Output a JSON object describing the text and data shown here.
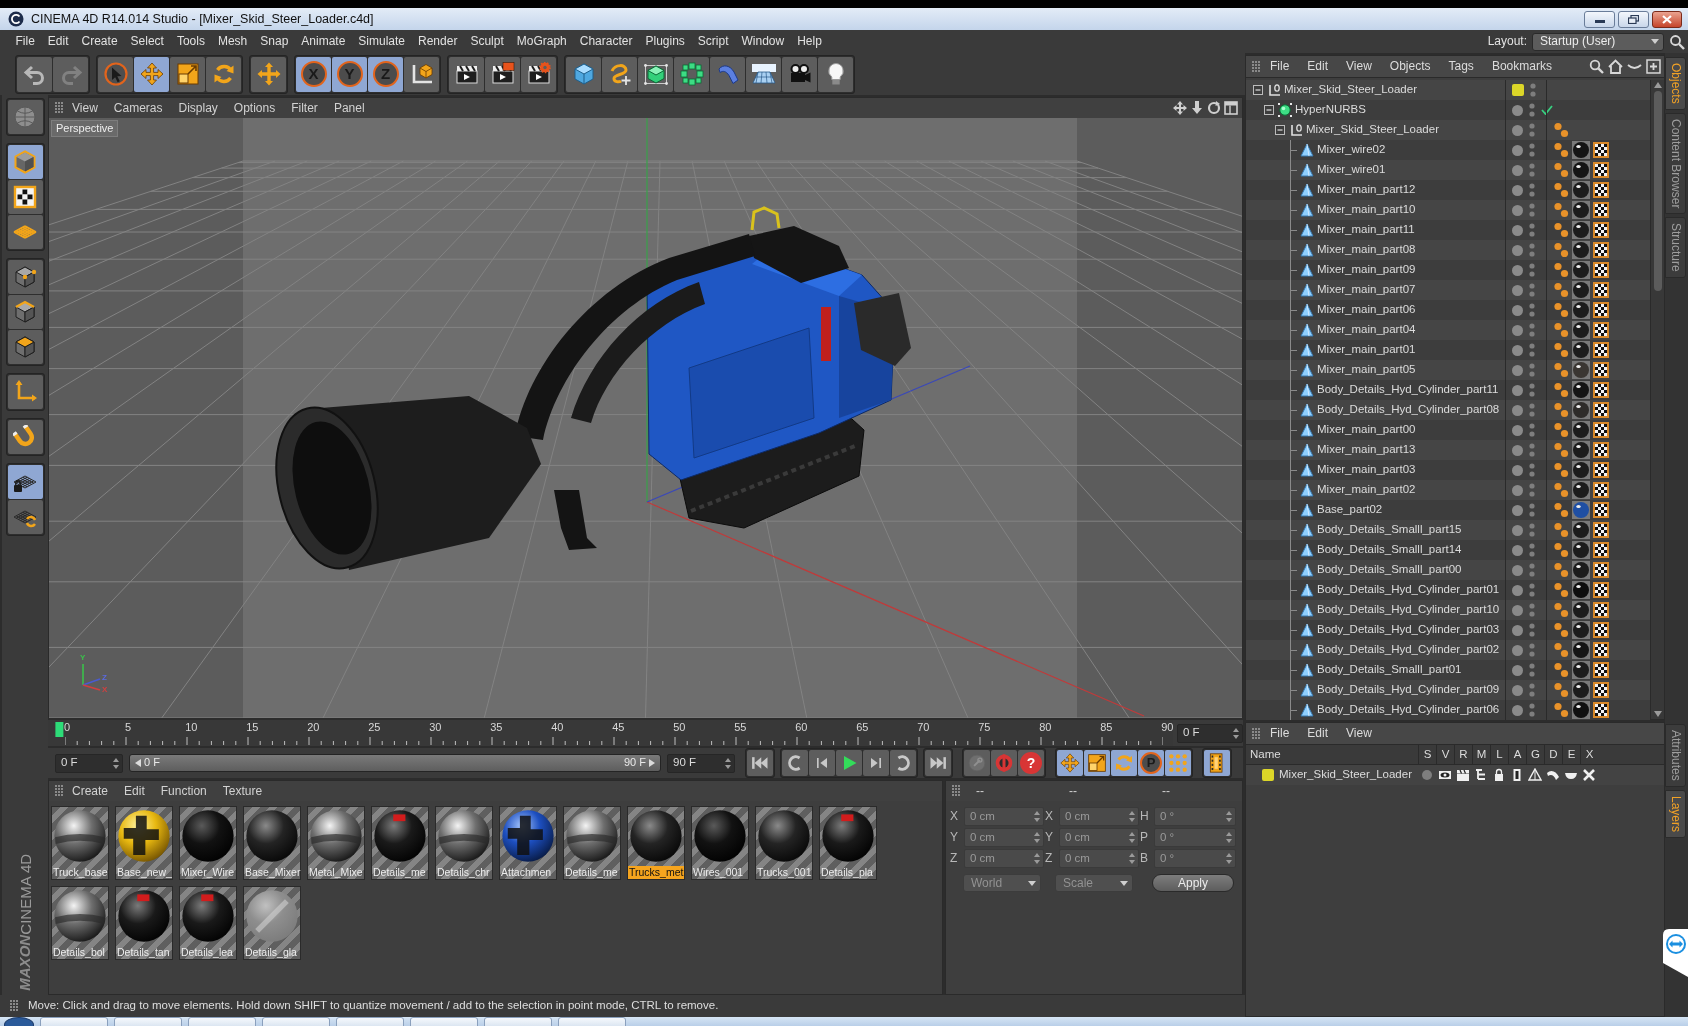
{
  "window": {
    "title": "CINEMA 4D R14.014 Studio - [Mixer_Skid_Steer_Loader.c4d]"
  },
  "menu": [
    "File",
    "Edit",
    "Create",
    "Select",
    "Tools",
    "Mesh",
    "Snap",
    "Animate",
    "Simulate",
    "Render",
    "Sculpt",
    "MoGraph",
    "Character",
    "Plugins",
    "Script",
    "Window",
    "Help"
  ],
  "layout": {
    "label": "Layout:",
    "value": "Startup (User)"
  },
  "toolbar": [
    [
      {
        "kind": "undo",
        "active": false,
        "disabled": false
      },
      {
        "kind": "redo",
        "active": false,
        "disabled": true
      }
    ],
    [
      {
        "kind": "select",
        "active": false,
        "disabled": false
      },
      {
        "kind": "move",
        "active": true,
        "disabled": false
      },
      {
        "kind": "scale",
        "active": false,
        "disabled": false
      },
      {
        "kind": "rotate",
        "active": false,
        "disabled": false
      }
    ],
    [
      {
        "kind": "last",
        "active": false,
        "disabled": false
      }
    ],
    [
      {
        "kind": "axis",
        "label": "X",
        "active": true,
        "disabled": false
      },
      {
        "kind": "axis",
        "label": "Y",
        "active": true,
        "disabled": false
      },
      {
        "kind": "axis",
        "label": "Z",
        "active": true,
        "disabled": false
      },
      {
        "kind": "coords",
        "active": false,
        "disabled": false
      }
    ],
    [
      {
        "kind": "renderview",
        "active": false,
        "disabled": false
      },
      {
        "kind": "renderpv",
        "active": false,
        "disabled": false
      },
      {
        "kind": "rendersettings",
        "active": false,
        "disabled": false
      }
    ],
    [
      {
        "kind": "cube",
        "active": false,
        "disabled": false
      },
      {
        "kind": "pen",
        "active": false,
        "disabled": false
      },
      {
        "kind": "subdivision",
        "active": false,
        "disabled": false
      },
      {
        "kind": "array",
        "active": false,
        "disabled": false
      },
      {
        "kind": "deformer",
        "active": false,
        "disabled": false
      },
      {
        "kind": "floor",
        "active": false,
        "disabled": false
      },
      {
        "kind": "camera",
        "active": false,
        "disabled": false
      },
      {
        "kind": "light",
        "active": false,
        "disabled": false
      }
    ]
  ],
  "left_tools": [
    [
      {
        "kind": "editable",
        "active": false
      }
    ],
    [
      {
        "kind": "model",
        "active": true
      },
      {
        "kind": "texture",
        "active": false
      },
      {
        "kind": "workplane",
        "active": false
      }
    ],
    [
      {
        "kind": "points",
        "active": false
      },
      {
        "kind": "edges",
        "active": false
      },
      {
        "kind": "polygons",
        "active": false
      }
    ],
    [
      {
        "kind": "axis",
        "active": false
      }
    ],
    [
      {
        "kind": "tweak",
        "active": false
      }
    ],
    [
      {
        "kind": "snap",
        "active": true
      },
      {
        "kind": "snapsettings",
        "active": false
      }
    ]
  ],
  "logo": {
    "brand": "MAXON",
    "product": "CINEMA 4D"
  },
  "viewport": {
    "menu": [
      "View",
      "Cameras",
      "Display",
      "Options",
      "Filter",
      "Panel"
    ],
    "camera": "Perspective",
    "gizmo": [
      "Y",
      "Z",
      "X"
    ]
  },
  "timeline": {
    "ticks": [
      "0",
      "5",
      "10",
      "15",
      "20",
      "25",
      "30",
      "35",
      "40",
      "45",
      "50",
      "55",
      "60",
      "65",
      "70",
      "75",
      "80",
      "85",
      "90"
    ],
    "playhead": {
      "level": 0
    },
    "frame": "0 F"
  },
  "playback": {
    "start": "0 F",
    "range": {
      "start": "0 F",
      "end": "90 F"
    },
    "end": "90 F",
    "transport": [
      [
        {
          "kind": "first"
        }
      ],
      [
        {
          "kind": "prevkey"
        },
        {
          "kind": "prevframe"
        },
        {
          "kind": "play"
        },
        {
          "kind": "nextframe"
        },
        {
          "kind": "nextkey"
        }
      ],
      [
        {
          "kind": "last"
        }
      ]
    ],
    "keys": [
      {
        "kind": "record",
        "disabled": true
      },
      {
        "kind": "autokey",
        "disabled": false
      },
      {
        "kind": "keyset",
        "label": "?",
        "disabled": false
      }
    ],
    "filters": [
      {
        "kind": "position",
        "active": true
      },
      {
        "kind": "scale",
        "active": true
      },
      {
        "kind": "rotation",
        "active": true
      },
      {
        "kind": "parameter",
        "label": "P",
        "active": true
      },
      {
        "kind": "points",
        "active": true
      }
    ],
    "timeline_active": true
  },
  "materials": {
    "menu": [
      "Create",
      "Edit",
      "Function",
      "Texture"
    ],
    "items": [
      {
        "name": "Truck_base",
        "kind": "chrome",
        "selected": false
      },
      {
        "name": "Base_new_",
        "kind": "yellow",
        "selected": false
      },
      {
        "name": "Mixer_Wire",
        "kind": "black",
        "selected": false
      },
      {
        "name": "Base_Mixer",
        "kind": "dark",
        "selected": false
      },
      {
        "name": "Metal_Mixe",
        "kind": "chrome",
        "selected": false
      },
      {
        "name": "Details_me",
        "kind": "tagged",
        "selected": false
      },
      {
        "name": "Details_chr",
        "kind": "chrome",
        "selected": false
      },
      {
        "name": "Attachmen",
        "kind": "blue",
        "selected": false
      },
      {
        "name": "Details_me",
        "kind": "chrome",
        "selected": false
      },
      {
        "name": "Trucks_met",
        "kind": "dark",
        "selected": true
      },
      {
        "name": "Wires_001",
        "kind": "black",
        "selected": false
      },
      {
        "name": "Trucks_001",
        "kind": "dark",
        "selected": false
      },
      {
        "name": "Details_pla",
        "kind": "tagged",
        "selected": false
      },
      {
        "name": "Details_bol",
        "kind": "chrome",
        "selected": false
      },
      {
        "name": "Details_tan",
        "kind": "tagged",
        "selected": false
      },
      {
        "name": "Details_lea",
        "kind": "tagged",
        "selected": false
      },
      {
        "name": "Details_gla",
        "kind": "glass",
        "selected": false
      }
    ]
  },
  "coordinates": {
    "disabled": true,
    "headers": [
      "--",
      "--",
      "--"
    ],
    "columns": [
      [
        {
          "axis": "X",
          "value": "0 cm"
        },
        {
          "axis": "Y",
          "value": "0 cm"
        },
        {
          "axis": "Z",
          "value": "0 cm"
        }
      ],
      [
        {
          "axis": "X",
          "value": "0 cm"
        },
        {
          "axis": "Y",
          "value": "0 cm"
        },
        {
          "axis": "Z",
          "value": "0 cm"
        }
      ],
      [
        {
          "axis": "H",
          "value": "0 °"
        },
        {
          "axis": "P",
          "value": "0 °"
        },
        {
          "axis": "B",
          "value": "0 °"
        }
      ]
    ],
    "dropdowns": [
      "World",
      "Scale"
    ],
    "apply": "Apply"
  },
  "objects": {
    "menu": [
      "File",
      "Edit",
      "View",
      "Objects",
      "Tags",
      "Bookmarks"
    ],
    "tree": [
      {
        "name": "Mixer_Skid_Steer_Loader",
        "kind": "null",
        "expanded": true,
        "color": "#dcd628",
        "children": [
          {
            "name": "HyperNURBS",
            "kind": "hypernurbs",
            "expanded": true,
            "enabled": true,
            "children": [
              {
                "name": "Mixer_Skid_Steer_Loader",
                "kind": "null",
                "expanded": true,
                "tags": [
                  {
                    "kind": "phong"
                  }
                ],
                "children": [
                  {
                    "name": "Mixer_wire02",
                    "kind": "polygon",
                    "tags": [
                      {
                        "kind": "phong"
                      },
                      {
                        "kind": "material",
                        "color": "#151515"
                      },
                      {
                        "kind": "texture"
                      }
                    ]
                  },
                  {
                    "name": "Mixer_wire01",
                    "kind": "polygon",
                    "tags": [
                      {
                        "kind": "phong"
                      },
                      {
                        "kind": "material",
                        "color": "#151515"
                      },
                      {
                        "kind": "texture"
                      }
                    ]
                  },
                  {
                    "name": "Mixer_main_part12",
                    "kind": "polygon",
                    "tags": [
                      {
                        "kind": "phong"
                      },
                      {
                        "kind": "material",
                        "color": "#1c1c1c"
                      },
                      {
                        "kind": "texture"
                      }
                    ]
                  },
                  {
                    "name": "Mixer_main_part10",
                    "kind": "polygon",
                    "tags": [
                      {
                        "kind": "phong"
                      },
                      {
                        "kind": "material",
                        "color": "#1c1c1c"
                      },
                      {
                        "kind": "texture"
                      }
                    ]
                  },
                  {
                    "name": "Mixer_main_part11",
                    "kind": "polygon",
                    "tags": [
                      {
                        "kind": "phong"
                      },
                      {
                        "kind": "material",
                        "color": "#1c1c1c"
                      },
                      {
                        "kind": "texture"
                      }
                    ]
                  },
                  {
                    "name": "Mixer_main_part08",
                    "kind": "polygon",
                    "tags": [
                      {
                        "kind": "phong"
                      },
                      {
                        "kind": "material",
                        "color": "#1c1c1c"
                      },
                      {
                        "kind": "texture"
                      }
                    ]
                  },
                  {
                    "name": "Mixer_main_part09",
                    "kind": "polygon",
                    "tags": [
                      {
                        "kind": "phong"
                      },
                      {
                        "kind": "material",
                        "color": "#1c1c1c"
                      },
                      {
                        "kind": "texture"
                      }
                    ]
                  },
                  {
                    "name": "Mixer_main_part07",
                    "kind": "polygon",
                    "tags": [
                      {
                        "kind": "phong"
                      },
                      {
                        "kind": "material",
                        "color": "#1c1c1c"
                      },
                      {
                        "kind": "texture"
                      }
                    ]
                  },
                  {
                    "name": "Mixer_main_part06",
                    "kind": "polygon",
                    "tags": [
                      {
                        "kind": "phong"
                      },
                      {
                        "kind": "material",
                        "color": "#1c1c1c"
                      },
                      {
                        "kind": "texture"
                      }
                    ]
                  },
                  {
                    "name": "Mixer_main_part04",
                    "kind": "polygon",
                    "tags": [
                      {
                        "kind": "phong"
                      },
                      {
                        "kind": "material",
                        "color": "#1c1c1c"
                      },
                      {
                        "kind": "texture"
                      }
                    ]
                  },
                  {
                    "name": "Mixer_main_part01",
                    "kind": "polygon",
                    "tags": [
                      {
                        "kind": "phong"
                      },
                      {
                        "kind": "material",
                        "color": "#1c1c1c"
                      },
                      {
                        "kind": "texture"
                      }
                    ]
                  },
                  {
                    "name": "Mixer_main_part05",
                    "kind": "polygon",
                    "tags": [
                      {
                        "kind": "phong"
                      },
                      {
                        "kind": "material",
                        "color": "#3a3632"
                      },
                      {
                        "kind": "texture"
                      }
                    ]
                  },
                  {
                    "name": "Body_Details_Hyd_Cylinder_part11",
                    "kind": "polygon",
                    "tags": [
                      {
                        "kind": "phong"
                      },
                      {
                        "kind": "material",
                        "color": "#151515"
                      },
                      {
                        "kind": "texture"
                      }
                    ]
                  },
                  {
                    "name": "Body_Details_Hyd_Cylinder_part08",
                    "kind": "polygon",
                    "tags": [
                      {
                        "kind": "phong"
                      },
                      {
                        "kind": "material",
                        "color": "#2e2c2a"
                      },
                      {
                        "kind": "texture"
                      }
                    ]
                  },
                  {
                    "name": "Mixer_main_part00",
                    "kind": "polygon",
                    "tags": [
                      {
                        "kind": "phong"
                      },
                      {
                        "kind": "material",
                        "color": "#1c1c1c"
                      },
                      {
                        "kind": "texture"
                      }
                    ]
                  },
                  {
                    "name": "Mixer_main_part13",
                    "kind": "polygon",
                    "tags": [
                      {
                        "kind": "phong"
                      },
                      {
                        "kind": "material",
                        "color": "#1c1c1c"
                      },
                      {
                        "kind": "texture"
                      }
                    ]
                  },
                  {
                    "name": "Mixer_main_part03",
                    "kind": "polygon",
                    "tags": [
                      {
                        "kind": "phong"
                      },
                      {
                        "kind": "material",
                        "color": "#1c1c1c"
                      },
                      {
                        "kind": "texture"
                      }
                    ]
                  },
                  {
                    "name": "Mixer_main_part02",
                    "kind": "polygon",
                    "tags": [
                      {
                        "kind": "phong"
                      },
                      {
                        "kind": "material",
                        "color": "#1c1c1c"
                      },
                      {
                        "kind": "texture"
                      }
                    ]
                  },
                  {
                    "name": "Base_part02",
                    "kind": "polygon",
                    "tags": [
                      {
                        "kind": "phong"
                      },
                      {
                        "kind": "material",
                        "color": "#1f4fa3"
                      },
                      {
                        "kind": "texture"
                      }
                    ]
                  },
                  {
                    "name": "Body_Details_Smalll_part15",
                    "kind": "polygon",
                    "tags": [
                      {
                        "kind": "phong"
                      },
                      {
                        "kind": "material",
                        "color": "#1c1c1c"
                      },
                      {
                        "kind": "texture"
                      }
                    ]
                  },
                  {
                    "name": "Body_Details_Smalll_part14",
                    "kind": "polygon",
                    "tags": [
                      {
                        "kind": "phong"
                      },
                      {
                        "kind": "material",
                        "color": "#1c1c1c"
                      },
                      {
                        "kind": "texture"
                      }
                    ]
                  },
                  {
                    "name": "Body_Details_Smalll_part00",
                    "kind": "polygon",
                    "tags": [
                      {
                        "kind": "phong"
                      },
                      {
                        "kind": "material",
                        "color": "#1c1c1c"
                      },
                      {
                        "kind": "texture"
                      }
                    ]
                  },
                  {
                    "name": "Body_Details_Hyd_Cylinder_part01",
                    "kind": "polygon",
                    "tags": [
                      {
                        "kind": "phong"
                      },
                      {
                        "kind": "material",
                        "color": "#0e0e0e"
                      },
                      {
                        "kind": "texture"
                      }
                    ]
                  },
                  {
                    "name": "Body_Details_Hyd_Cylinder_part10",
                    "kind": "polygon",
                    "tags": [
                      {
                        "kind": "phong"
                      },
                      {
                        "kind": "material",
                        "color": "#1c1c1c"
                      },
                      {
                        "kind": "texture"
                      }
                    ]
                  },
                  {
                    "name": "Body_Details_Hyd_Cylinder_part03",
                    "kind": "polygon",
                    "tags": [
                      {
                        "kind": "phong"
                      },
                      {
                        "kind": "material",
                        "color": "#1c1c1c"
                      },
                      {
                        "kind": "texture"
                      }
                    ]
                  },
                  {
                    "name": "Body_Details_Hyd_Cylinder_part02",
                    "kind": "polygon",
                    "tags": [
                      {
                        "kind": "phong"
                      },
                      {
                        "kind": "material",
                        "color": "#151515"
                      },
                      {
                        "kind": "texture"
                      }
                    ]
                  },
                  {
                    "name": "Body_Details_Smalll_part01",
                    "kind": "polygon",
                    "tags": [
                      {
                        "kind": "phong"
                      },
                      {
                        "kind": "material",
                        "color": "#1c1c1c"
                      },
                      {
                        "kind": "texture"
                      }
                    ]
                  },
                  {
                    "name": "Body_Details_Hyd_Cylinder_part09",
                    "kind": "polygon",
                    "tags": [
                      {
                        "kind": "phong"
                      },
                      {
                        "kind": "material",
                        "color": "#1c1c1c"
                      },
                      {
                        "kind": "texture"
                      }
                    ]
                  },
                  {
                    "name": "Body_Details_Hyd_Cylinder_part06",
                    "kind": "polygon",
                    "tags": [
                      {
                        "kind": "phong"
                      },
                      {
                        "kind": "material",
                        "color": "#101010"
                      },
                      {
                        "kind": "texture"
                      }
                    ]
                  }
                ]
              }
            ]
          }
        ]
      }
    ]
  },
  "layers": {
    "menu": [
      "File",
      "Edit",
      "View"
    ],
    "columns": [
      "Name",
      "S",
      "V",
      "R",
      "M",
      "L",
      "A",
      "G",
      "D",
      "E",
      "X"
    ],
    "rows": [
      {
        "name": "Mixer_Skid_Steer_Loader",
        "color": "#dcd628",
        "toggles": [
          false,
          true,
          true,
          true,
          true,
          true,
          true,
          true,
          true,
          true
        ]
      }
    ]
  },
  "side_tabs": [
    {
      "label": "Objects",
      "selected": true
    },
    {
      "label": "Content Browser",
      "selected": false
    },
    {
      "label": "Structure",
      "selected": false
    }
  ],
  "side_tabs_lower": [
    {
      "label": "Attributes",
      "selected": false
    },
    {
      "label": "Layers",
      "selected": true
    }
  ],
  "status": "Move: Click and drag to move elements. Hold down SHIFT to quantize movement / add to the selection in point mode, CTRL to remove."
}
